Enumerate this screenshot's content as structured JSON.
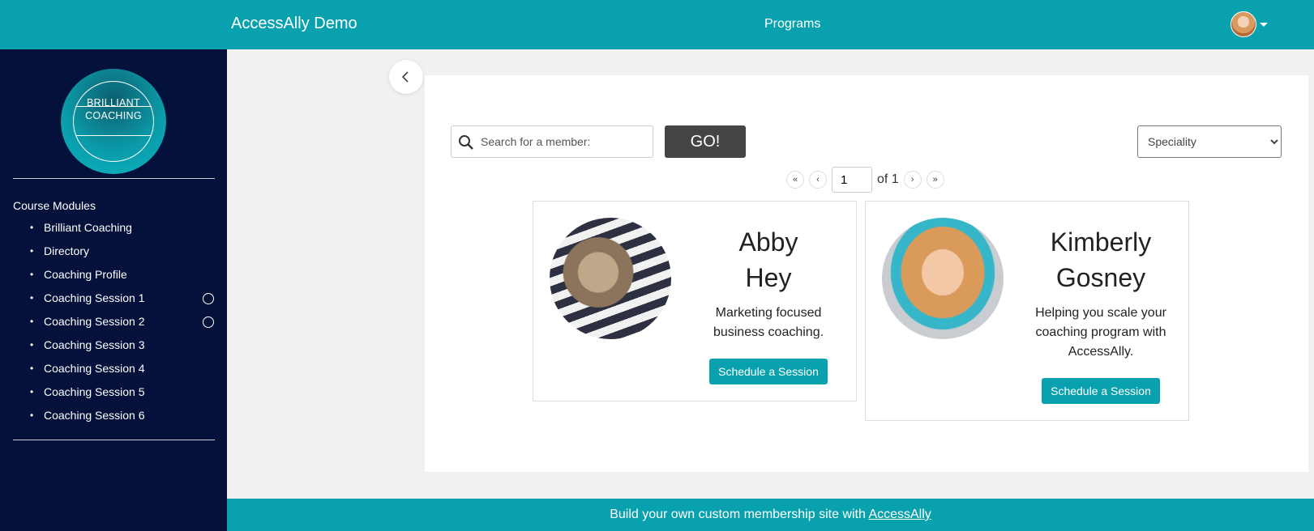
{
  "header": {
    "site_title": "AccessAlly Demo",
    "nav_programs": "Programs"
  },
  "sidebar": {
    "logo_line1": "BRILLIANT",
    "logo_line2": "COACHING",
    "modules_heading": "Course Modules",
    "items": [
      {
        "label": "Brilliant Coaching",
        "has_status": false
      },
      {
        "label": "Directory",
        "has_status": false
      },
      {
        "label": "Coaching Profile",
        "has_status": false
      },
      {
        "label": "Coaching Session 1",
        "has_status": true
      },
      {
        "label": "Coaching Session 2",
        "has_status": true
      },
      {
        "label": "Coaching Session 3",
        "has_status": false
      },
      {
        "label": "Coaching Session 4",
        "has_status": false
      },
      {
        "label": "Coaching Session 5",
        "has_status": false
      },
      {
        "label": "Coaching Session 6",
        "has_status": false
      }
    ]
  },
  "directory": {
    "search_placeholder": "Search for a member:",
    "go_label": "GO!",
    "speciality_selected": "Speciality",
    "pager": {
      "first": "«",
      "prev": "‹",
      "page": "1",
      "of_text": "of 1",
      "next": "›",
      "last": "»"
    },
    "members": [
      {
        "name_line1": "Abby",
        "name_line2": "Hey",
        "description": "Marketing focused business coaching.",
        "button_label": "Schedule a Session"
      },
      {
        "name_line1": "Kimberly",
        "name_line2": "Gosney",
        "description": "Helping you scale your coaching program with AccessAlly.",
        "button_label": "Schedule a Session"
      }
    ]
  },
  "footer": {
    "text": "Build your own custom membership site with ",
    "link": "AccessAlly"
  },
  "colors": {
    "brand_teal": "#0aa1ae",
    "sidebar_navy": "#03113b",
    "go_button": "#444444"
  }
}
